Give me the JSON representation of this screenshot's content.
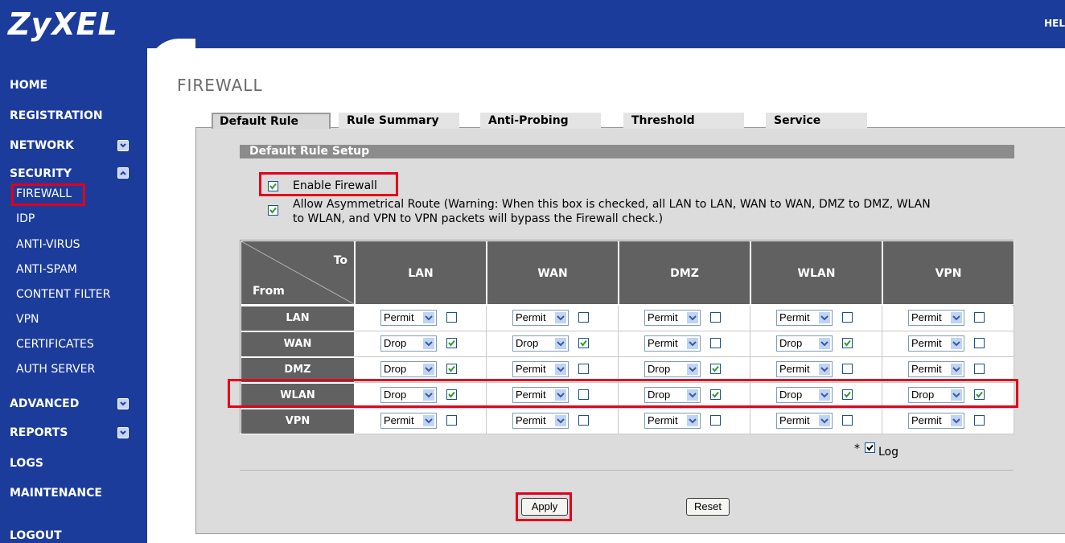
{
  "brand": {
    "logo": "ZyXEL",
    "help": "HEL"
  },
  "sidebar": {
    "main": [
      {
        "label": "HOME"
      },
      {
        "label": "REGISTRATION"
      },
      {
        "label": "NETWORK"
      },
      {
        "label": "SECURITY"
      },
      {
        "label": "ADVANCED"
      },
      {
        "label": "REPORTS"
      },
      {
        "label": "LOGS"
      },
      {
        "label": "MAINTENANCE"
      },
      {
        "label": "LOGOUT"
      }
    ],
    "security_items": [
      {
        "label": "FIREWALL"
      },
      {
        "label": "IDP"
      },
      {
        "label": "ANTI-VIRUS"
      },
      {
        "label": "ANTI-SPAM"
      },
      {
        "label": "CONTENT FILTER"
      },
      {
        "label": "VPN"
      },
      {
        "label": "CERTIFICATES"
      },
      {
        "label": "AUTH SERVER"
      }
    ]
  },
  "page": {
    "title": "FIREWALL"
  },
  "tabs": [
    {
      "label": "Default Rule",
      "active": true
    },
    {
      "label": "Rule Summary",
      "active": false
    },
    {
      "label": "Anti-Probing",
      "active": false
    },
    {
      "label": "Threshold",
      "active": false
    },
    {
      "label": "Service",
      "active": false
    }
  ],
  "setup": {
    "section_title": "Default Rule Setup",
    "enable_firewall_label": "Enable Firewall",
    "enable_firewall_checked": true,
    "asym_label_line1": "Allow Asymmetrical Route (Warning: When this box is checked, all LAN to LAN, WAN to WAN, DMZ to DMZ, WLAN",
    "asym_label_line2": "to WLAN, and VPN to VPN packets will bypass the Firewall check.)",
    "asym_checked": true
  },
  "matrix": {
    "corner_to": "To",
    "corner_from": "From",
    "columns": [
      "LAN",
      "WAN",
      "DMZ",
      "WLAN",
      "VPN"
    ],
    "rows": [
      {
        "label": "LAN",
        "cells": [
          {
            "action": "Permit",
            "log": false
          },
          {
            "action": "Permit",
            "log": false
          },
          {
            "action": "Permit",
            "log": false
          },
          {
            "action": "Permit",
            "log": false
          },
          {
            "action": "Permit",
            "log": false
          }
        ]
      },
      {
        "label": "WAN",
        "cells": [
          {
            "action": "Drop",
            "log": true
          },
          {
            "action": "Drop",
            "log": true
          },
          {
            "action": "Permit",
            "log": false
          },
          {
            "action": "Drop",
            "log": true
          },
          {
            "action": "Permit",
            "log": false
          }
        ]
      },
      {
        "label": "DMZ",
        "cells": [
          {
            "action": "Drop",
            "log": true
          },
          {
            "action": "Permit",
            "log": false
          },
          {
            "action": "Drop",
            "log": true
          },
          {
            "action": "Permit",
            "log": false
          },
          {
            "action": "Permit",
            "log": false
          }
        ]
      },
      {
        "label": "WLAN",
        "cells": [
          {
            "action": "Drop",
            "log": true
          },
          {
            "action": "Permit",
            "log": false
          },
          {
            "action": "Drop",
            "log": true
          },
          {
            "action": "Drop",
            "log": true
          },
          {
            "action": "Drop",
            "log": true
          }
        ]
      },
      {
        "label": "VPN",
        "cells": [
          {
            "action": "Permit",
            "log": false
          },
          {
            "action": "Permit",
            "log": false
          },
          {
            "action": "Permit",
            "log": false
          },
          {
            "action": "Permit",
            "log": false
          },
          {
            "action": "Permit",
            "log": false
          }
        ]
      }
    ]
  },
  "log": {
    "prefix": "*",
    "label": "Log",
    "checked": true
  },
  "buttons": {
    "apply": "Apply",
    "reset": "Reset"
  },
  "colors": {
    "nav_bg": "#1c3c9c",
    "header_cell": "#616161",
    "highlight": "#e3001b",
    "check": "#2a9d2a"
  }
}
